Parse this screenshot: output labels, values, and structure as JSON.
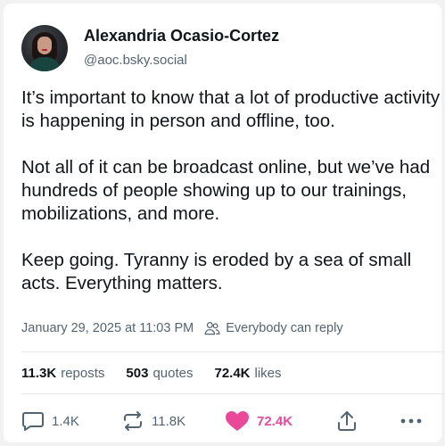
{
  "author": {
    "display_name": "Alexandria Ocasio-Cortez",
    "handle": "@aoc.bsky.social",
    "avatar_icon": "avatar-photo"
  },
  "post": {
    "paragraphs": [
      "It’s important to know that a lot of productive activity is happening in person and offline, too.",
      "Not all of it can be broadcast online, but we’ve had hundreds of people showing up to our trainings, mobilizations, and more.",
      "Keep going. Tyranny is eroded by a sea of small acts. Everything matters."
    ],
    "timestamp": "January 29, 2025 at 11:03 PM",
    "reply_setting": "Everybody can reply"
  },
  "stats": {
    "reposts_count": "11.3K",
    "reposts_label": "reposts",
    "quotes_count": "503",
    "quotes_label": "quotes",
    "likes_count": "72.4K",
    "likes_label": "likes"
  },
  "actions": {
    "reply_count": "1.4K",
    "repost_count": "11.8K",
    "like_count": "72.4K",
    "reply_icon": "speech-bubble-icon",
    "repost_icon": "repost-arrows-icon",
    "like_icon": "heart-icon",
    "share_icon": "share-icon",
    "more_icon": "more-dots-icon"
  },
  "colors": {
    "like_active": "#ec4899",
    "secondary_text": "#536471",
    "primary_text": "#0f1419"
  }
}
